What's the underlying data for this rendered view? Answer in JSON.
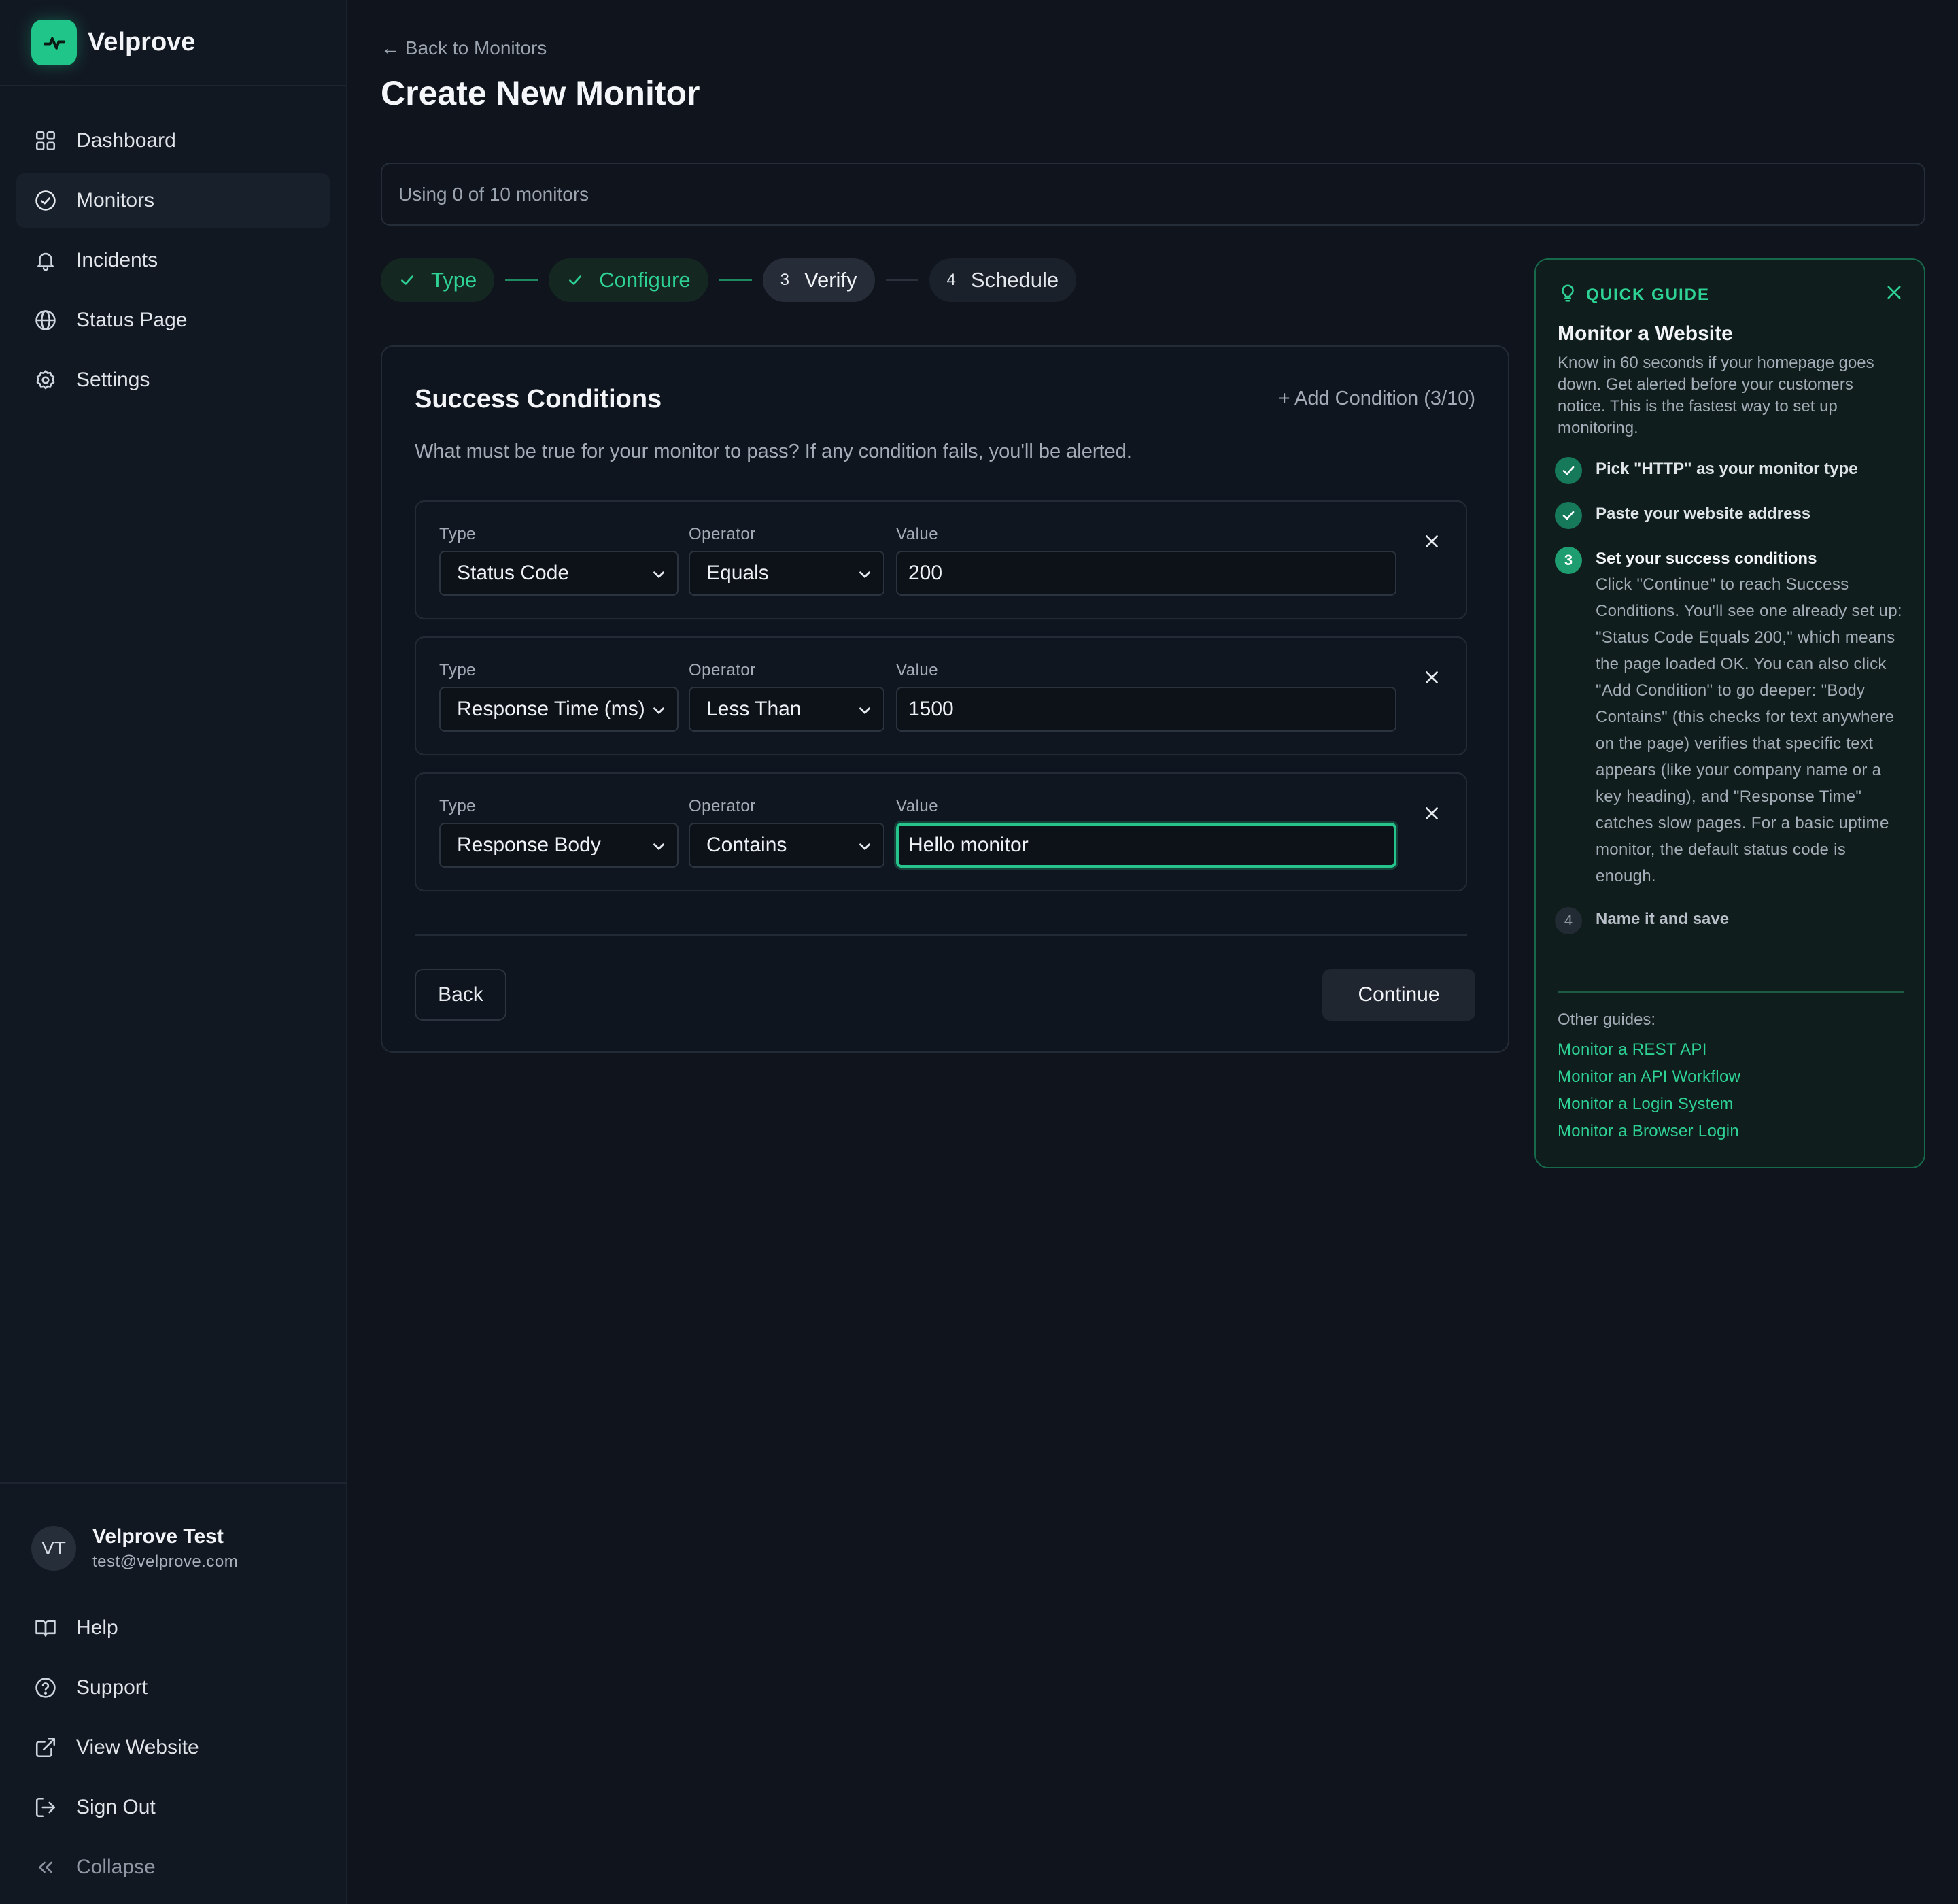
{
  "brand": {
    "name": "Velprove"
  },
  "sidebar": {
    "items": [
      {
        "label": "Dashboard",
        "icon": "grid-icon"
      },
      {
        "label": "Monitors",
        "icon": "check-circle-icon",
        "active": true
      },
      {
        "label": "Incidents",
        "icon": "bell-icon"
      },
      {
        "label": "Status Page",
        "icon": "globe-icon"
      },
      {
        "label": "Settings",
        "icon": "gear-icon"
      }
    ],
    "user": {
      "initials": "VT",
      "name": "Velprove Test",
      "email": "test@velprove.com"
    },
    "bottom_items": [
      {
        "label": "Help",
        "icon": "book-icon"
      },
      {
        "label": "Support",
        "icon": "help-circle-icon"
      },
      {
        "label": "View Website",
        "icon": "external-link-icon"
      },
      {
        "label": "Sign Out",
        "icon": "sign-out-icon"
      },
      {
        "label": "Collapse",
        "icon": "double-chevron-left-icon"
      }
    ]
  },
  "header": {
    "back_link": "← Back to Monitors",
    "title": "Create New Monitor",
    "usage": "Using 0 of 10 monitors"
  },
  "stepper": {
    "steps": [
      {
        "label": "Type",
        "state": "done"
      },
      {
        "label": "Configure",
        "state": "done"
      },
      {
        "number": "3",
        "label": "Verify",
        "state": "current"
      },
      {
        "number": "4",
        "label": "Schedule",
        "state": "pending"
      }
    ]
  },
  "card": {
    "title": "Success Conditions",
    "add_condition": "+ Add Condition (3/10)",
    "description": "What must be true for your monitor to pass? If any condition fails, you'll be alerted.",
    "labels": {
      "type": "Type",
      "operator": "Operator",
      "value": "Value"
    },
    "conditions": [
      {
        "type": "Status Code",
        "operator": "Equals",
        "value": "200"
      },
      {
        "type": "Response Time (ms)",
        "operator": "Less Than",
        "value": "1500"
      },
      {
        "type": "Response Body",
        "operator": "Contains",
        "value": "Hello monitor",
        "focused": true
      }
    ],
    "back_label": "Back",
    "continue_label": "Continue"
  },
  "guide": {
    "kicker": "QUICK GUIDE",
    "title": "Monitor a Website",
    "intro": "Know in 60 seconds if your homepage goes down. Get alerted before your customers notice. This is the fastest way to set up monitoring.",
    "steps": [
      {
        "state": "done",
        "label": "Pick \"HTTP\" as your monitor type"
      },
      {
        "state": "done",
        "label": "Paste your website address"
      },
      {
        "state": "current",
        "number": "3",
        "label": "Set your success conditions",
        "detail": "Click \"Continue\" to reach Success Conditions. You'll see one already set up: \"Status Code Equals 200,\" which means the page loaded OK. You can also click \"Add Condition\" to go deeper: \"Body Contains\" (this checks for text anywhere on the page) verifies that specific text appears (like your company name or a key heading), and \"Response Time\" catches slow pages. For a basic uptime monitor, the default status code is enough."
      },
      {
        "state": "pending",
        "number": "4",
        "label": "Name it and save"
      }
    ],
    "other_label": "Other guides:",
    "other_guides": [
      "Monitor a REST API",
      "Monitor an API Workflow",
      "Monitor a Login System",
      "Monitor a Browser Login"
    ]
  },
  "colors": {
    "accent": "#2ed295",
    "background": "#0f141d",
    "sidebar": "#121822",
    "guide_border": "#17694c"
  }
}
